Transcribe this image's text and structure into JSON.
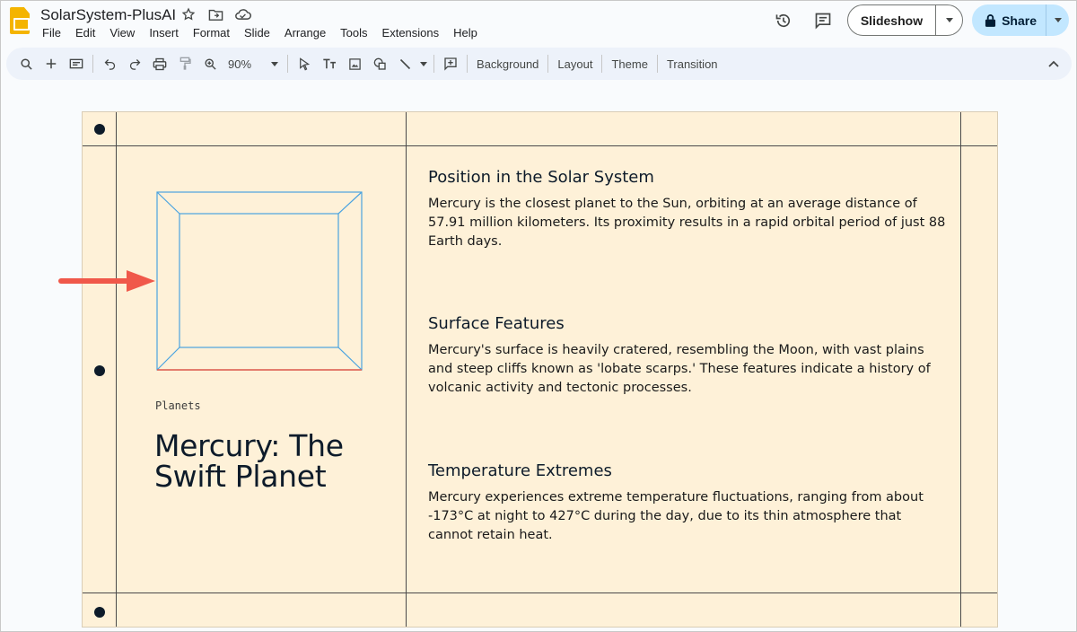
{
  "app": {
    "title": "SolarSystem-PlusAI",
    "menu": [
      "File",
      "Edit",
      "View",
      "Insert",
      "Format",
      "Slide",
      "Arrange",
      "Tools",
      "Extensions",
      "Help"
    ],
    "slideshow_label": "Slideshow",
    "share_label": "Share"
  },
  "toolbar": {
    "zoom": "90%",
    "background_label": "Background",
    "layout_label": "Layout",
    "theme_label": "Theme",
    "transition_label": "Transition"
  },
  "slide": {
    "tag": "Planets",
    "title": "Mercury: The Swift Planet",
    "sections": [
      {
        "heading": "Position in the Solar System",
        "body": "Mercury is the closest planet to the Sun, orbiting at an average distance of 57.91 million kilometers. Its proximity results in a rapid orbital period of just 88 Earth days."
      },
      {
        "heading": "Surface Features",
        "body": "Mercury's surface is heavily cratered, resembling the Moon, with vast plains and steep cliffs known as 'lobate scarps.' These features indicate a history of volcanic activity and tectonic processes."
      },
      {
        "heading": "Temperature Extremes",
        "body": "Mercury experiences extreme temperature fluctuations, ranging from about -173°C at night to 427°C during the day, due to its thin atmosphere that cannot retain heat."
      }
    ]
  },
  "colors": {
    "slide_background": "#fef1d8",
    "annotation_arrow": "#f0584a",
    "placeholder_outline": "#4aa3e0",
    "share_button": "#c2e7ff"
  }
}
